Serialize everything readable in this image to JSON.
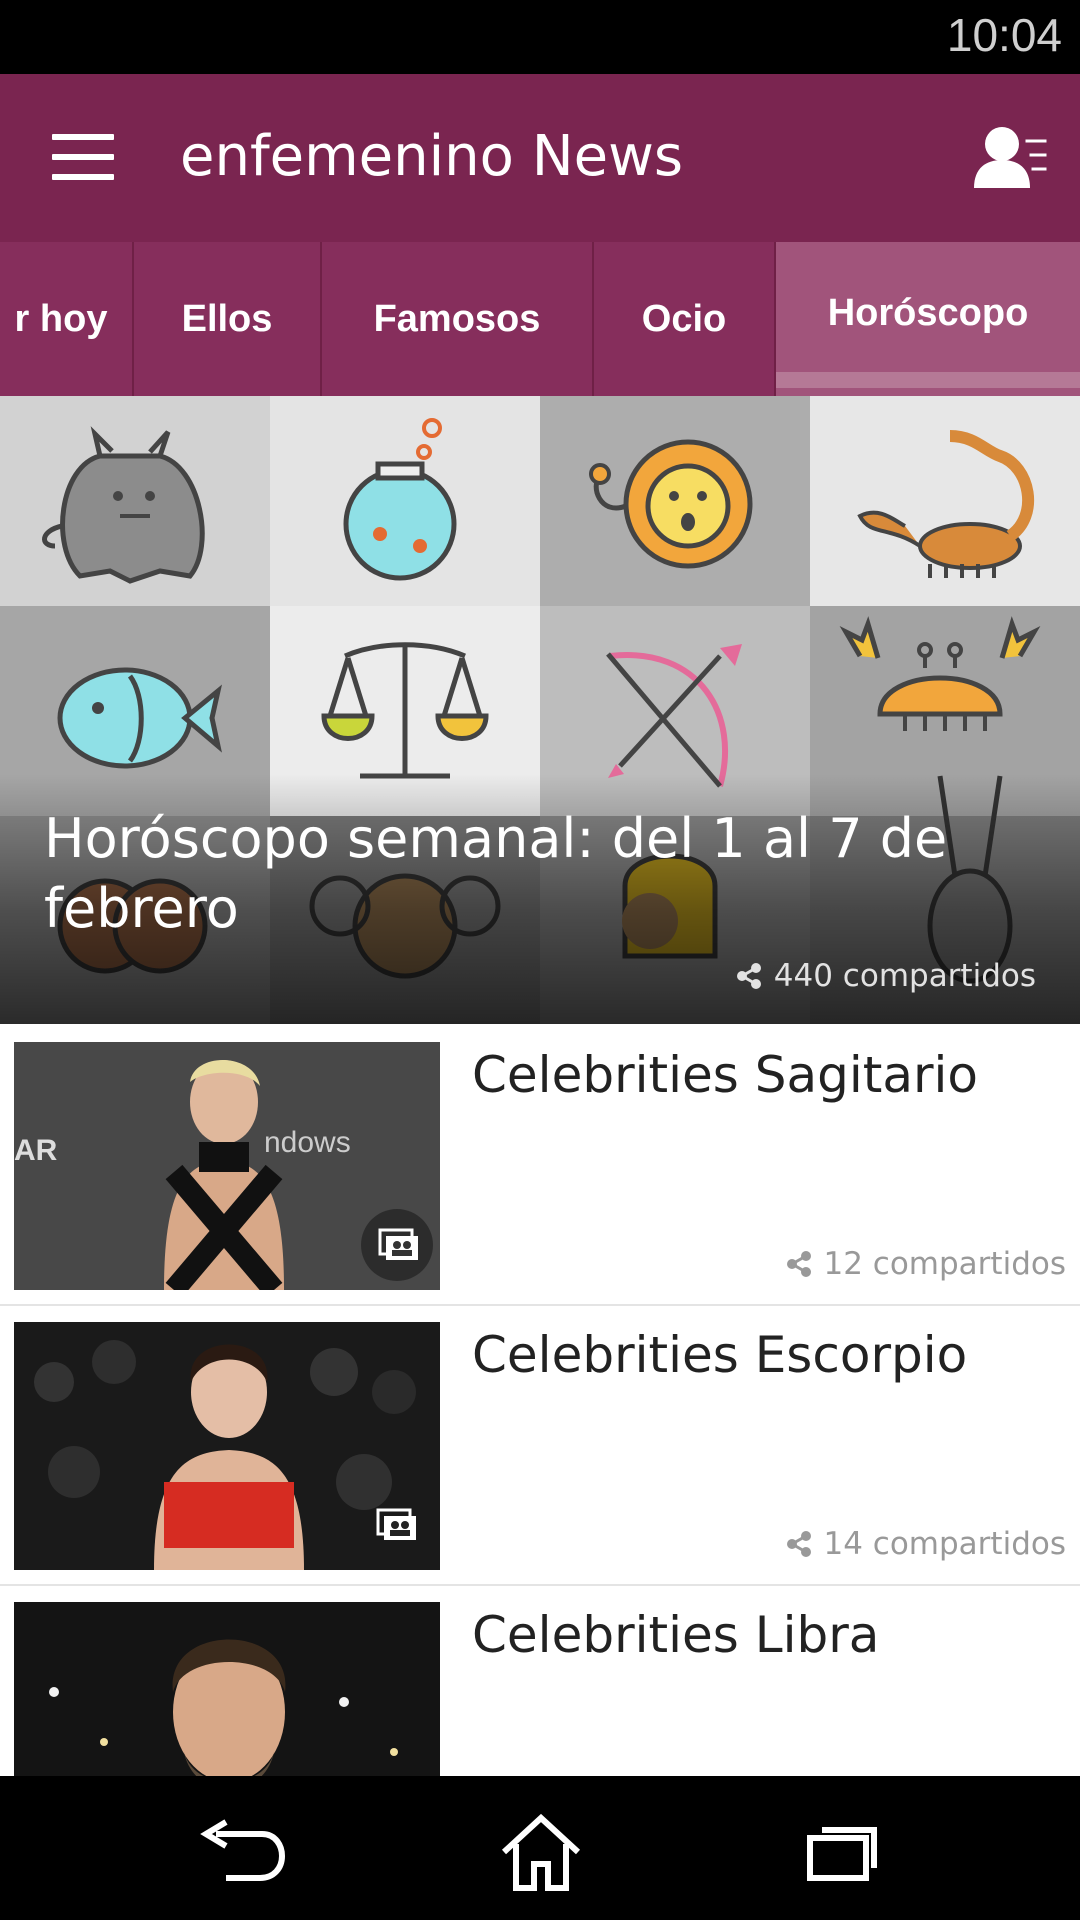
{
  "status_bar": {
    "time": "10:04"
  },
  "app_bar": {
    "title": "enfemenino News"
  },
  "tabs": [
    {
      "label": "r hoy",
      "active": false
    },
    {
      "label": "Ellos",
      "active": false
    },
    {
      "label": "Famosos",
      "active": false
    },
    {
      "label": "Ocio",
      "active": false
    },
    {
      "label": "Horóscopo",
      "active": true
    }
  ],
  "hero": {
    "title": "Horóscopo semanal: del 1 al 7 de febrero",
    "shares": "440 compartidos"
  },
  "articles": [
    {
      "title": "Celebrities Sagitario",
      "shares": "12 compartidos",
      "gallery": true
    },
    {
      "title": "Celebrities Escorpio",
      "shares": "14 compartidos",
      "gallery": true
    },
    {
      "title": "Celebrities Libra",
      "shares": "",
      "gallery": false
    }
  ],
  "icons": {
    "menu": "menu-icon",
    "profile": "profile-settings-icon",
    "share": "share-icon",
    "gallery": "photo-gallery-icon",
    "nav_back": "back-icon",
    "nav_home": "home-icon",
    "nav_recents": "recents-icon"
  },
  "colors": {
    "app_bar": "#7a2550",
    "tabs_bg": "#862e5c",
    "tab_active": "#a1547b"
  }
}
